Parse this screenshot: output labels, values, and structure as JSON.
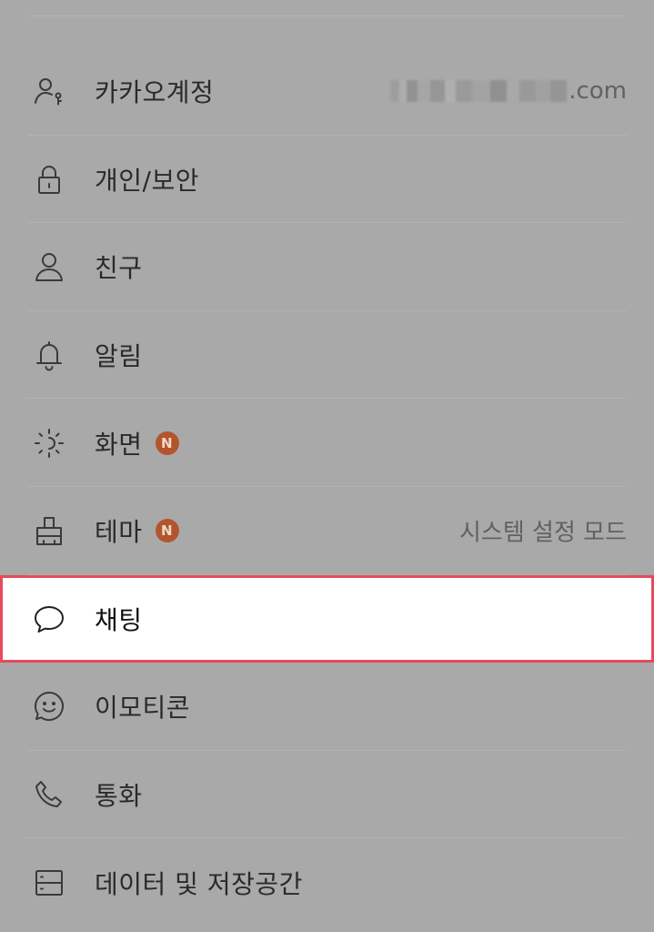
{
  "settings": {
    "items": [
      {
        "id": "kakao-account",
        "icon": "account-key-icon",
        "label": "카카오계정",
        "value_suffix": ".com",
        "value_masked": true
      },
      {
        "id": "privacy",
        "icon": "lock-icon",
        "label": "개인/보안"
      },
      {
        "id": "friends",
        "icon": "person-icon",
        "label": "친구"
      },
      {
        "id": "notifications",
        "icon": "bell-icon",
        "label": "알림"
      },
      {
        "id": "display",
        "icon": "brightness-icon",
        "label": "화면",
        "badge": "N"
      },
      {
        "id": "theme",
        "icon": "theme-brush-icon",
        "label": "테마",
        "badge": "N",
        "value": "시스템 설정 모드"
      },
      {
        "id": "chat",
        "icon": "chat-bubble-icon",
        "label": "채팅",
        "selected": true
      },
      {
        "id": "emoticons",
        "icon": "emoticon-icon",
        "label": "이모티콘"
      },
      {
        "id": "calls",
        "icon": "phone-icon",
        "label": "통화"
      },
      {
        "id": "data-storage",
        "icon": "storage-icon",
        "label": "데이터 및 저장공간"
      }
    ]
  },
  "colors": {
    "background": "#a9a9a9",
    "highlight_border": "#e54b5c",
    "badge": "#b3552c"
  }
}
